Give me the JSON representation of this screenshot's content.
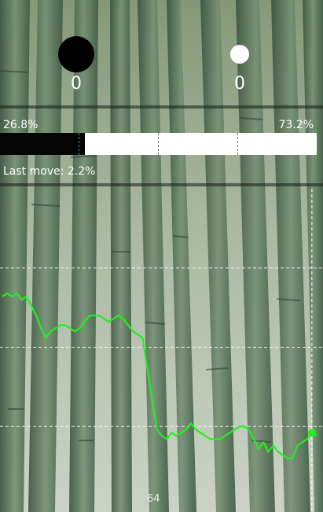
{
  "players": {
    "black": {
      "score": "0",
      "win_rate": "26.8%"
    },
    "white": {
      "score": "0",
      "win_rate": "73.2%"
    }
  },
  "win_rate_bar": {
    "black_fraction": 0.268
  },
  "last_move": {
    "label": "Last move: 2.2%"
  },
  "move_marker": {
    "number": "64"
  },
  "colors": {
    "graph_line": "#22ee22",
    "black": "#000000",
    "white": "#ffffff"
  },
  "chart_data": {
    "type": "line",
    "series": [
      {
        "values": [
          66,
          67,
          66,
          67,
          65,
          66,
          63,
          60,
          56,
          53,
          55,
          56,
          57,
          57,
          56,
          55,
          56,
          58,
          60,
          60,
          60,
          59,
          58,
          59,
          60,
          59,
          57,
          55,
          54,
          53,
          43,
          33,
          24,
          22,
          21,
          23,
          22,
          23,
          24,
          26,
          24,
          23,
          22,
          21,
          21,
          21,
          22,
          23,
          24,
          25,
          25,
          24,
          21,
          18,
          20,
          17,
          19,
          17,
          16,
          15,
          15,
          19,
          20,
          21,
          23,
          22
        ]
      }
    ],
    "ylim": [
      0,
      100
    ],
    "xlim": [
      0,
      65
    ],
    "current_move": 64,
    "grid": true
  }
}
